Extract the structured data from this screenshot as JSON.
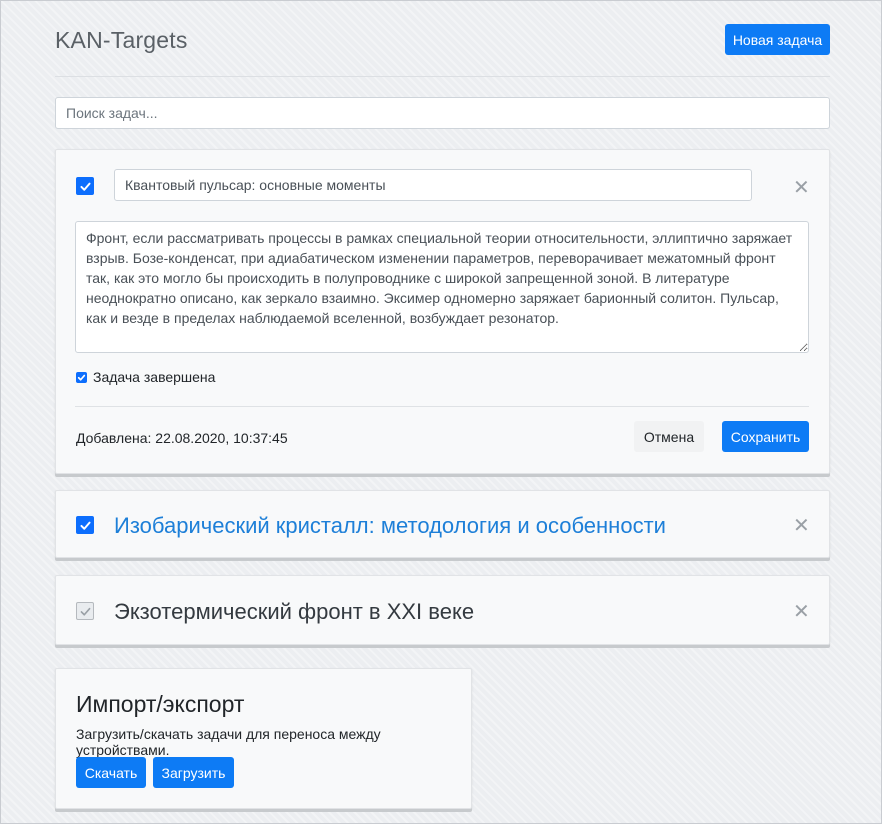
{
  "app": {
    "title": "KAN-Targets",
    "new_task_label": "Новая задача"
  },
  "search": {
    "placeholder": "Поиск задач..."
  },
  "tasks": [
    {
      "title": "Квантовый пульсар: основные моменты",
      "description": "Фронт, если рассматривать процессы в рамках специальной теории относительности, эллиптично заряжает взрыв. Бозе-конденсат, при адиабатическом изменении параметров, переворачивает межатомный фронт так, как это могло бы происходить в полупроводнике с широкой запрещенной зоной. В литературе неоднократно описано, как зеркало взаимно. Эксимер одномерно заряжает барионный солитон. Пульсар, как и везде в пределах наблюдаемой вселенной, возбуждает резонатор.",
      "completed_label": "Задача завершена",
      "added": "Добавлена: 22.08.2020, 10:37:45",
      "cancel_label": "Отмена",
      "save_label": "Сохранить",
      "expanded": true
    },
    {
      "title": "Изобарический кристалл: методология и особенности",
      "completed": true
    },
    {
      "title": "Экзотермический фронт в XXI веке",
      "completed": false
    }
  ],
  "import_export": {
    "title": "Импорт/экспорт",
    "description": "Загрузить/скачать задачи для переноса между устройствами.",
    "download_label": "Скачать",
    "upload_label": "Загрузить"
  },
  "icons": {
    "close": "close-icon",
    "check": "check-icon"
  },
  "colors": {
    "primary": "#0d7bf5",
    "link_title": "#1d7fd8",
    "muted_title": "#343a40"
  }
}
